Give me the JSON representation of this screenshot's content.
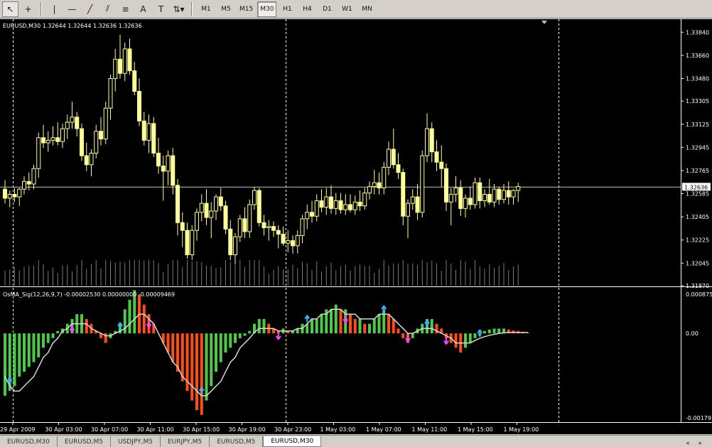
{
  "toolbar": {
    "tools": [
      {
        "name": "cursor-tool-button",
        "icon": "cursor-arrow-icon",
        "glyph": "↖",
        "active": true
      },
      {
        "name": "crosshair-tool-button",
        "icon": "crosshair-icon",
        "glyph": "+",
        "active": false
      },
      {
        "name": "vertical-line-tool-button",
        "icon": "vertical-line-icon",
        "glyph": "|",
        "active": false
      },
      {
        "name": "horizontal-line-tool-button",
        "icon": "horizontal-line-icon",
        "glyph": "—",
        "active": false
      },
      {
        "name": "trendline-tool-button",
        "icon": "trendline-icon",
        "glyph": "╱",
        "active": false
      },
      {
        "name": "equidistant-channel-tool-button",
        "icon": "channel-icon",
        "glyph": "⫽",
        "active": false
      },
      {
        "name": "fibonacci-tool-button",
        "icon": "fibonacci-icon",
        "glyph": "≡",
        "active": false
      },
      {
        "name": "text-tool-button",
        "icon": "text-icon",
        "glyph": "A",
        "active": false
      },
      {
        "name": "text-label-tool-button",
        "icon": "text-label-icon",
        "glyph": "T",
        "active": false
      },
      {
        "name": "arrows-tool-button",
        "icon": "arrows-dropdown-icon",
        "glyph": "⇅▾",
        "active": false
      }
    ],
    "timeframes": [
      {
        "label": "M1",
        "active": false
      },
      {
        "label": "M5",
        "active": false
      },
      {
        "label": "M15",
        "active": false
      },
      {
        "label": "M30",
        "active": true
      },
      {
        "label": "H1",
        "active": false
      },
      {
        "label": "H4",
        "active": false
      },
      {
        "label": "D1",
        "active": false
      },
      {
        "label": "W1",
        "active": false
      },
      {
        "label": "MN",
        "active": false
      }
    ]
  },
  "chart_data": [
    {
      "type": "candlestick",
      "title": "EURUSD,M30  1.32644 1.32644 1.32636 1.32636",
      "ylim": [
        1.3187,
        1.3393
      ],
      "ticks": [
        "1.33840",
        "1.33660",
        "1.33480",
        "1.33305",
        "1.33125",
        "1.32945",
        "1.32765",
        "1.32585",
        "1.32405",
        "1.32225",
        "1.32045",
        "1.31870"
      ],
      "tick_values": [
        1.3384,
        1.3366,
        1.3348,
        1.33305,
        1.33125,
        1.32945,
        1.32765,
        1.32585,
        1.32405,
        1.32225,
        1.32045,
        1.3187
      ],
      "current_price": "1.32636",
      "current_price_value": 1.32636,
      "x_labels": [
        "29 Apr 2009",
        "30 Apr 03:00",
        "30 Apr 07:00",
        "30 Apr 11:00",
        "30 Apr 15:00",
        "30 Apr 19:00",
        "30 Apr 23:00",
        "1 May 03:00",
        "1 May 07:00",
        "1 May 11:00",
        "1 May 15:00",
        "1 May 19:00"
      ],
      "candle_color": "#ffff99",
      "background": "#000000",
      "candles": [
        [
          1.3262,
          1.3269,
          1.3251,
          1.3255
        ],
        [
          1.3255,
          1.3261,
          1.3248,
          1.3258
        ],
        [
          1.3258,
          1.3263,
          1.3252,
          1.3256
        ],
        [
          1.3256,
          1.3263,
          1.3249,
          1.3262
        ],
        [
          1.3262,
          1.3272,
          1.3258,
          1.3268
        ],
        [
          1.3268,
          1.3275,
          1.3261,
          1.3266
        ],
        [
          1.3266,
          1.3281,
          1.3262,
          1.3278
        ],
        [
          1.3278,
          1.3306,
          1.3271,
          1.3302
        ],
        [
          1.3302,
          1.3312,
          1.3294,
          1.3298
        ],
        [
          1.3298,
          1.3307,
          1.3291,
          1.33
        ],
        [
          1.33,
          1.3311,
          1.3296,
          1.3302
        ],
        [
          1.3302,
          1.3314,
          1.3296,
          1.3299
        ],
        [
          1.3299,
          1.3313,
          1.3294,
          1.3309
        ],
        [
          1.3309,
          1.332,
          1.3301,
          1.3314
        ],
        [
          1.3314,
          1.333,
          1.3309,
          1.3318
        ],
        [
          1.3318,
          1.3322,
          1.3303,
          1.3309
        ],
        [
          1.3309,
          1.3313,
          1.3284,
          1.3288
        ],
        [
          1.3288,
          1.3298,
          1.3276,
          1.3281
        ],
        [
          1.3281,
          1.3293,
          1.3272,
          1.329
        ],
        [
          1.329,
          1.3312,
          1.3286,
          1.3307
        ],
        [
          1.3307,
          1.3318,
          1.3296,
          1.3301
        ],
        [
          1.3301,
          1.333,
          1.3297,
          1.3325
        ],
        [
          1.3325,
          1.3351,
          1.3316,
          1.3348
        ],
        [
          1.3348,
          1.3371,
          1.3338,
          1.3363
        ],
        [
          1.3363,
          1.3382,
          1.3348,
          1.3352
        ],
        [
          1.3352,
          1.3376,
          1.3346,
          1.3371
        ],
        [
          1.3371,
          1.3379,
          1.3351,
          1.3354
        ],
        [
          1.3354,
          1.3361,
          1.3335,
          1.3338
        ],
        [
          1.3338,
          1.3348,
          1.3311,
          1.3315
        ],
        [
          1.3315,
          1.3322,
          1.3296,
          1.33
        ],
        [
          1.33,
          1.332,
          1.329,
          1.3313
        ],
        [
          1.3313,
          1.3318,
          1.3287,
          1.329
        ],
        [
          1.329,
          1.3302,
          1.3274,
          1.328
        ],
        [
          1.328,
          1.3288,
          1.3253,
          1.3276
        ],
        [
          1.3276,
          1.3292,
          1.3265,
          1.3288
        ],
        [
          1.3288,
          1.3294,
          1.3258,
          1.3265
        ],
        [
          1.3265,
          1.327,
          1.3226,
          1.3236
        ],
        [
          1.3236,
          1.3244,
          1.3217,
          1.323
        ],
        [
          1.323,
          1.3236,
          1.3208,
          1.3211
        ],
        [
          1.3211,
          1.3234,
          1.3207,
          1.323
        ],
        [
          1.323,
          1.3247,
          1.3222,
          1.3244
        ],
        [
          1.3244,
          1.3258,
          1.3237,
          1.3251
        ],
        [
          1.3251,
          1.3262,
          1.3234,
          1.324
        ],
        [
          1.324,
          1.3252,
          1.3224,
          1.3245
        ],
        [
          1.3245,
          1.3258,
          1.3238,
          1.3256
        ],
        [
          1.3256,
          1.3263,
          1.3245,
          1.3249
        ],
        [
          1.3249,
          1.3253,
          1.3227,
          1.3231
        ],
        [
          1.3231,
          1.3238,
          1.3207,
          1.3211
        ],
        [
          1.3211,
          1.3228,
          1.3204,
          1.3225
        ],
        [
          1.3225,
          1.3242,
          1.3221,
          1.3239
        ],
        [
          1.3239,
          1.3248,
          1.3224,
          1.3229
        ],
        [
          1.3229,
          1.3254,
          1.3224,
          1.325
        ],
        [
          1.325,
          1.3264,
          1.3246,
          1.3261
        ],
        [
          1.3261,
          1.3263,
          1.3233,
          1.3236
        ],
        [
          1.3236,
          1.3242,
          1.3226,
          1.3232
        ],
        [
          1.3232,
          1.3238,
          1.3222,
          1.3233
        ],
        [
          1.3233,
          1.3237,
          1.3225,
          1.323
        ],
        [
          1.323,
          1.3234,
          1.3216,
          1.3227
        ],
        [
          1.3227,
          1.3233,
          1.3218,
          1.322
        ],
        [
          1.322,
          1.323,
          1.3213,
          1.3222
        ],
        [
          1.3222,
          1.3226,
          1.3212,
          1.3218
        ],
        [
          1.3218,
          1.323,
          1.3212,
          1.3226
        ],
        [
          1.3226,
          1.3242,
          1.322,
          1.3239
        ],
        [
          1.3239,
          1.325,
          1.3231,
          1.3244
        ],
        [
          1.3244,
          1.3253,
          1.3236,
          1.3241
        ],
        [
          1.3241,
          1.3258,
          1.3237,
          1.3253
        ],
        [
          1.3253,
          1.3262,
          1.3244,
          1.3248
        ],
        [
          1.3248,
          1.3263,
          1.3242,
          1.3256
        ],
        [
          1.3256,
          1.3265,
          1.3243,
          1.3247
        ],
        [
          1.3247,
          1.3259,
          1.3242,
          1.3253
        ],
        [
          1.3253,
          1.3259,
          1.3243,
          1.3246
        ],
        [
          1.3246,
          1.3258,
          1.3242,
          1.325
        ],
        [
          1.325,
          1.3258,
          1.3244,
          1.3246
        ],
        [
          1.3246,
          1.3257,
          1.3242,
          1.3252
        ],
        [
          1.3252,
          1.3261,
          1.3245,
          1.3249
        ],
        [
          1.3249,
          1.3263,
          1.3246,
          1.3259
        ],
        [
          1.3259,
          1.3268,
          1.3254,
          1.3264
        ],
        [
          1.3264,
          1.3277,
          1.3258,
          1.3267
        ],
        [
          1.3267,
          1.3275,
          1.3258,
          1.3263
        ],
        [
          1.3263,
          1.3283,
          1.3258,
          1.3279
        ],
        [
          1.3279,
          1.3299,
          1.3273,
          1.3293
        ],
        [
          1.3293,
          1.3309,
          1.3278,
          1.3281
        ],
        [
          1.3281,
          1.329,
          1.327,
          1.3275
        ],
        [
          1.3275,
          1.3278,
          1.3234,
          1.3241
        ],
        [
          1.3241,
          1.3254,
          1.3224,
          1.3251
        ],
        [
          1.3251,
          1.3262,
          1.3246,
          1.3256
        ],
        [
          1.3256,
          1.3266,
          1.3238,
          1.3244
        ],
        [
          1.3244,
          1.3292,
          1.324,
          1.3288
        ],
        [
          1.3288,
          1.3321,
          1.3283,
          1.3309
        ],
        [
          1.3309,
          1.3314,
          1.3283,
          1.3291
        ],
        [
          1.3291,
          1.33,
          1.3276,
          1.3283
        ],
        [
          1.3283,
          1.3296,
          1.3264,
          1.3278
        ],
        [
          1.3278,
          1.3282,
          1.3245,
          1.3252
        ],
        [
          1.3252,
          1.3263,
          1.3234,
          1.3258
        ],
        [
          1.3258,
          1.3272,
          1.3252,
          1.3263
        ],
        [
          1.3263,
          1.3269,
          1.3241,
          1.3247
        ],
        [
          1.3247,
          1.3258,
          1.324,
          1.3255
        ],
        [
          1.3255,
          1.3264,
          1.3246,
          1.325
        ],
        [
          1.325,
          1.3271,
          1.3247,
          1.3267
        ],
        [
          1.3267,
          1.3271,
          1.3247,
          1.3253
        ],
        [
          1.3253,
          1.3262,
          1.3248,
          1.3258
        ],
        [
          1.3258,
          1.327,
          1.325,
          1.3252
        ],
        [
          1.3252,
          1.3266,
          1.3248,
          1.3262
        ],
        [
          1.3262,
          1.3264,
          1.325,
          1.3254
        ],
        [
          1.3254,
          1.3266,
          1.3251,
          1.3261
        ],
        [
          1.3261,
          1.3268,
          1.325,
          1.3256
        ],
        [
          1.3256,
          1.3262,
          1.325,
          1.3261
        ],
        [
          1.3261,
          1.3267,
          1.3252,
          1.3264
        ]
      ],
      "volume_note": "tick volume bars shown in gray along the bottom of the price panel"
    },
    {
      "type": "bar",
      "title": "OsMA_Sig(12,26,9,7) -0.00002530 0.00000000 -0.00009469",
      "ylim": [
        -0.00179,
        0.000875
      ],
      "ticks": [
        "0.000875",
        "0.00",
        "-0.00179"
      ],
      "tick_values": [
        0.000875,
        0,
        -0.00179
      ],
      "colors": {
        "rising": "#4ec94a",
        "falling": "#ff4d1a",
        "signal_line": "#d8d8d8",
        "arrow_up": "#3fb0ff",
        "arrow_down": "#ff44ff"
      },
      "values": [
        -0.0013,
        -0.0012,
        -0.0011,
        -0.0009,
        -0.0008,
        -0.0007,
        -0.0006,
        -0.0005,
        -0.0003,
        -0.0002,
        -0.0001,
        5e-05,
        0.0001,
        0.0002,
        0.0003,
        0.0004,
        0.0004,
        0.0003,
        0.0002,
        5e-05,
        -0.0001,
        -0.0002,
        -0.0001,
        5e-05,
        0.0002,
        0.0005,
        0.0007,
        0.0009,
        0.0008,
        0.0006,
        0.0004,
        0.0002,
        0.0,
        -0.0002,
        -0.0004,
        -0.0006,
        -0.0008,
        -0.001,
        -0.0012,
        -0.0014,
        -0.0016,
        -0.0017,
        -0.0014,
        -0.0011,
        -0.0008,
        -0.0006,
        -0.0004,
        -0.0003,
        -0.0002,
        -0.0001,
        -5e-05,
        5e-05,
        0.0002,
        0.0003,
        0.0003,
        0.0002,
        0.0001,
        5e-05,
        0.0001,
        5e-05,
        5e-05,
        0.0001,
        0.0002,
        0.0002,
        0.0003,
        0.0003,
        0.0004,
        0.0005,
        0.0005,
        0.0006,
        0.0005,
        0.0005,
        0.0004,
        0.0003,
        0.0003,
        0.0002,
        0.0002,
        0.0003,
        0.0004,
        0.0005,
        0.0004,
        0.0003,
        0.0001,
        -0.0001,
        -0.0002,
        -0.0001,
        0.0001,
        0.0002,
        0.0003,
        0.0003,
        0.0002,
        0.0001,
        -0.0001,
        -0.0002,
        -0.0003,
        -0.0004,
        -0.0003,
        -0.0002,
        -0.0001,
        -5e-05,
        5e-05,
        8e-05,
        0.0001,
        0.0001,
        0.0001,
        8e-05,
        6e-05,
        5e-05,
        3e-05,
        2e-05
      ],
      "signal": [
        -0.0009,
        -0.0011,
        -0.0012,
        -0.0012,
        -0.0011,
        -0.001,
        -0.0009,
        -0.0007,
        -0.0005,
        -0.0004,
        -0.0002,
        -0.0001,
        5e-05,
        0.0001,
        0.0002,
        0.0002,
        0.0002,
        0.0002,
        0.0001,
        5e-05,
        0.0,
        -5e-05,
        -5e-05,
        0.0,
        5e-05,
        0.0001,
        0.0002,
        0.0003,
        0.0004,
        0.0004,
        0.0003,
        0.0002,
        0.0,
        -0.0002,
        -0.0004,
        -0.0006,
        -0.0007,
        -0.0009,
        -0.001,
        -0.0011,
        -0.0012,
        -0.0013,
        -0.0013,
        -0.0012,
        -0.0011,
        -0.001,
        -0.0008,
        -0.0006,
        -0.0005,
        -0.0003,
        -0.0002,
        -0.0001,
        2e-05,
        0.0001,
        0.0001,
        0.0001,
        0.0001,
        5e-05,
        5e-05,
        5e-05,
        5e-05,
        0.0001,
        0.0001,
        0.0002,
        0.0003,
        0.0003,
        0.0004,
        0.0004,
        0.0005,
        0.0005,
        0.0005,
        0.0004,
        0.0004,
        0.0004,
        0.0003,
        0.0003,
        0.0003,
        0.0003,
        0.0004,
        0.0004,
        0.0004,
        0.0003,
        0.0002,
        0.0001,
        0.0,
        0.0,
        5e-05,
        0.0001,
        0.0001,
        0.0001,
        5e-05,
        0.0,
        -5e-05,
        -0.0001,
        -0.0002,
        -0.0002,
        -0.0002,
        -0.0002,
        -0.00015,
        -0.0001,
        -7e-05,
        -4e-05,
        -2e-05,
        0.0,
        1e-05,
        2e-05,
        2e-05,
        2e-05,
        2e-05,
        2e-05
      ],
      "arrows": [
        {
          "index": 1,
          "dir": "up"
        },
        {
          "index": 14,
          "dir": "down"
        },
        {
          "index": 24,
          "dir": "up"
        },
        {
          "index": 30,
          "dir": "down"
        },
        {
          "index": 41,
          "dir": "up"
        },
        {
          "index": 57,
          "dir": "down"
        },
        {
          "index": 63,
          "dir": "up"
        },
        {
          "index": 71,
          "dir": "down"
        },
        {
          "index": 79,
          "dir": "up"
        },
        {
          "index": 84,
          "dir": "down"
        },
        {
          "index": 88,
          "dir": "up"
        },
        {
          "index": 92,
          "dir": "down"
        },
        {
          "index": 99,
          "dir": "up"
        }
      ]
    }
  ],
  "tabs": [
    {
      "label": "EURUSD,M30",
      "active": false
    },
    {
      "label": "EURUSD,M5",
      "active": false
    },
    {
      "label": "USDJPY,M5",
      "active": false
    },
    {
      "label": "EURJPY,M5",
      "active": false
    },
    {
      "label": "EURUSD,M5",
      "active": false
    },
    {
      "label": "EURUSD,M30",
      "active": true
    }
  ],
  "tab_nav": {
    "prev": "◂",
    "next": "▸"
  }
}
